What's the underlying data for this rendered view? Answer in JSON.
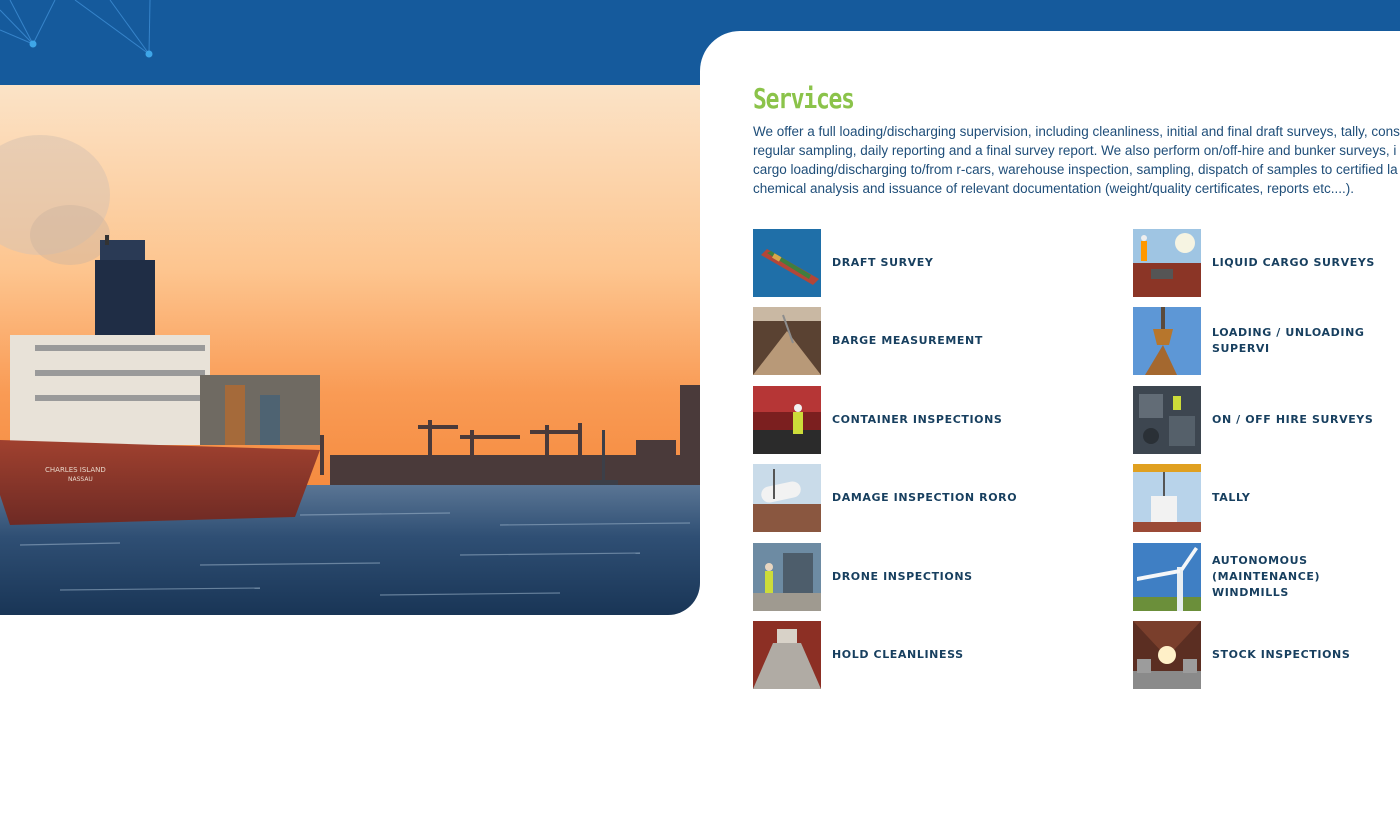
{
  "section": {
    "title": "Services",
    "description_lines": [
      "We offer a full loading/discharging supervision, including cleanliness, initial and final draft surveys, tally, cons",
      "regular sampling, daily reporting and a final survey report. We also perform on/off-hire and bunker surveys, i",
      "cargo loading/discharging to/from r-cars, warehouse inspection, sampling, dispatch of samples to certified la",
      "chemical analysis and issuance of relevant documentation (weight/quality certificates, reports etc....)."
    ]
  },
  "hero": {
    "image": "container ship leaving harbour at sunset",
    "ship_name": "CHARLES ISLAND",
    "ship_port": "NASSAU"
  },
  "services": [
    {
      "label": "DRAFT SURVEY",
      "icon": "aerial-container-ship-photo"
    },
    {
      "label": "LIQUID CARGO SURVEYS",
      "icon": "inspector-on-tanker-deck-photo"
    },
    {
      "label": "BARGE MEASUREMENT",
      "icon": "bulk-grain-in-hold-photo"
    },
    {
      "label": "LOADING / UNLOADING SUPERVI",
      "icon": "grab-crane-bulk-photo"
    },
    {
      "label": "CONTAINER INSPECTIONS",
      "icon": "container-inspector-photo"
    },
    {
      "label": "ON / OFF HIRE SURVEYS",
      "icon": "ship-deck-machinery-photo"
    },
    {
      "label": "DAMAGE INSPECTION RORO",
      "icon": "roro-cargo-deck-photo"
    },
    {
      "label": "TALLY",
      "icon": "crane-lifting-bags-photo"
    },
    {
      "label": "DRONE INSPECTIONS",
      "icon": "drone-operator-photo"
    },
    {
      "label": "AUTONOMOUS (MAINTENANCE)\nWINDMILLS",
      "icon": "wind-turbine-photo"
    },
    {
      "label": "HOLD CLEANLINESS",
      "icon": "empty-cargo-hold-photo"
    },
    {
      "label": "STOCK INSPECTIONS",
      "icon": "steel-coil-warehouse-photo"
    }
  ],
  "colors": {
    "band": "#155a9c",
    "title": "#8bc34a",
    "text": "#1f4e79",
    "label": "#173f5f"
  }
}
